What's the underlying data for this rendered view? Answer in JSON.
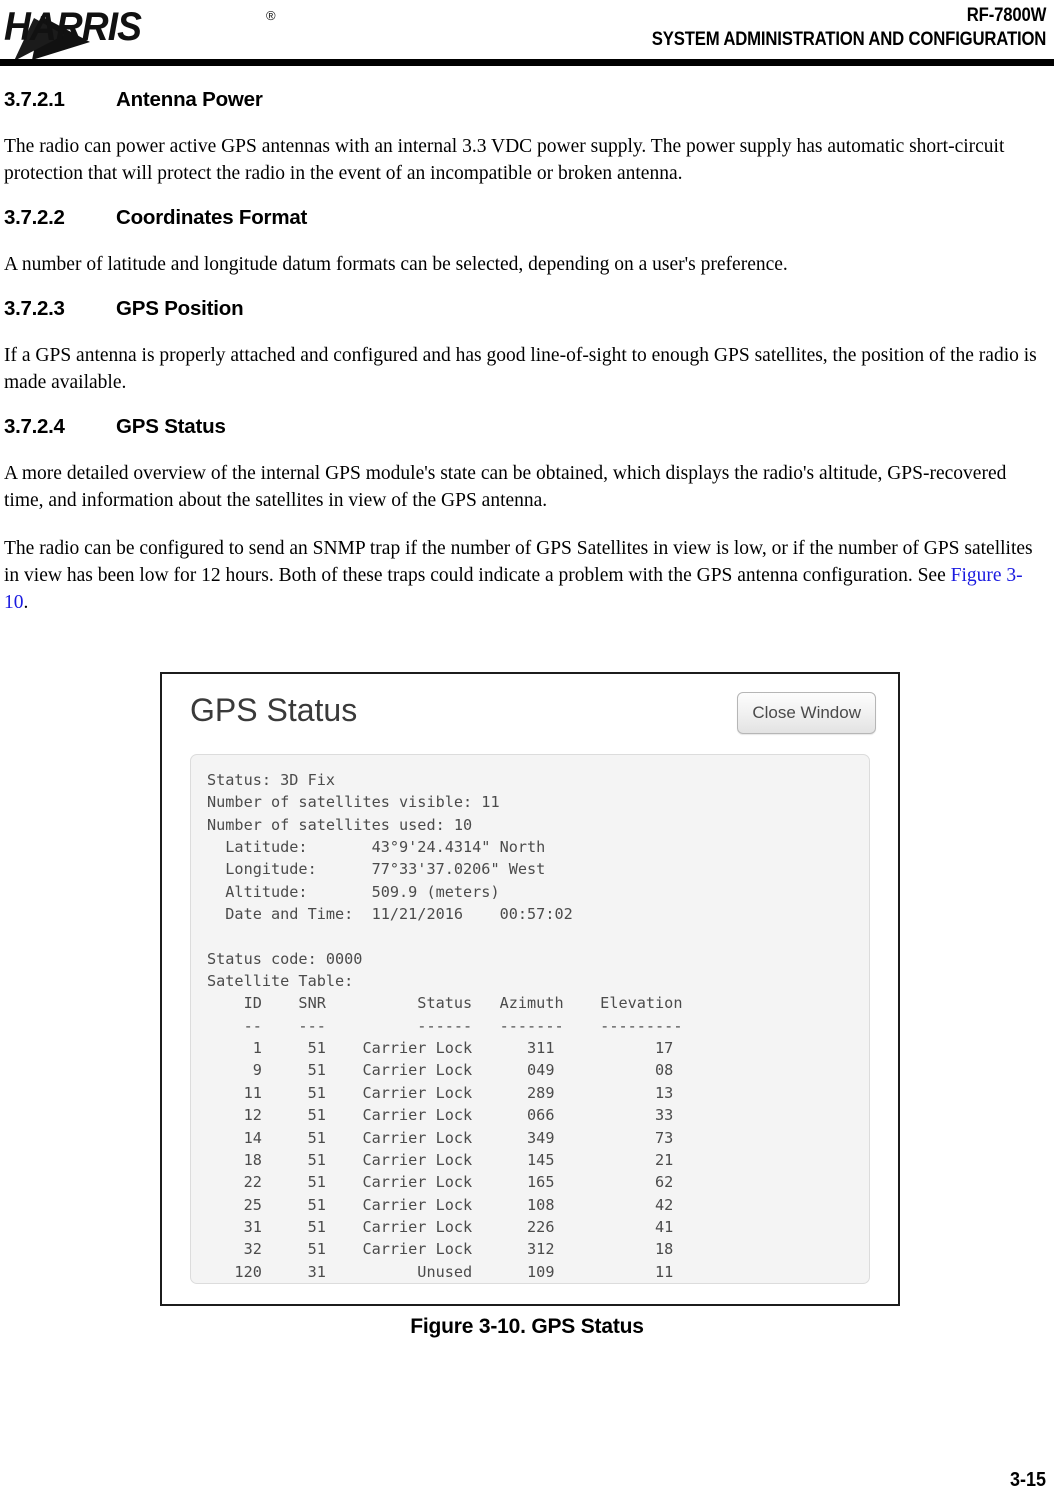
{
  "header": {
    "logo_text": "HARRIS",
    "logo_registered": "®",
    "title_line1": "RF-7800W",
    "title_line2": "SYSTEM ADMINISTRATION AND CONFIGURATION"
  },
  "sections": [
    {
      "number": "3.7.2.1",
      "title": "Antenna Power",
      "body": "The radio can power active GPS antennas with an internal 3.3 VDC power supply. The power supply has automatic short-circuit protection that will protect the radio in the event of an incompatible or broken antenna."
    },
    {
      "number": "3.7.2.2",
      "title": "Coordinates Format",
      "body": "A number of latitude and longitude datum formats can be selected, depending on a user's preference."
    },
    {
      "number": "3.7.2.3",
      "title": "GPS Position",
      "body": "If a GPS antenna is properly attached and configured and has good line-of-sight to enough GPS satellites, the position of the radio is made available."
    },
    {
      "number": "3.7.2.4",
      "title": "GPS Status",
      "body": "A more detailed overview of the internal GPS module's state can be obtained, which displays the radio's altitude, GPS-recovered time, and information about the satellites in view of the GPS antenna."
    }
  ],
  "paragraph_snmp": {
    "before_xref": "The radio can be configured to send an SNMP trap if the number of GPS Satellites in view is low, or if the number of GPS satellites in view has been low for 12 hours. Both of these traps could indicate a problem with the GPS antenna configuration. See ",
    "xref": "Figure 3-10",
    "after_xref": "."
  },
  "figure": {
    "caption": "Figure 3-10.  GPS Status",
    "dialog": {
      "title": "GPS Status",
      "close_button": "Close Window",
      "status_lines": [
        "Status: 3D Fix",
        "Number of satellites visible: 11",
        "Number of satellites used: 10",
        "  Latitude:       43°9'24.4314\" North",
        "  Longitude:      77°33'37.0206\" West",
        "  Altitude:       509.9 (meters)",
        "  Date and Time:  11/21/2016    00:57:02",
        "",
        "Status code: 0000",
        "Satellite Table:",
        "    ID    SNR          Status   Azimuth    Elevation",
        "    --    ---          ------   -------    ---------",
        "     1     51    Carrier Lock      311           17",
        "     9     51    Carrier Lock      049           08",
        "    11     51    Carrier Lock      289           13",
        "    12     51    Carrier Lock      066           33",
        "    14     51    Carrier Lock      349           73",
        "    18     51    Carrier Lock      145           21",
        "    22     51    Carrier Lock      165           62",
        "    25     51    Carrier Lock      108           42",
        "    31     51    Carrier Lock      226           41",
        "    32     51    Carrier Lock      312           18",
        "   120     31          Unused      109           11"
      ],
      "fields": {
        "status": "3D Fix",
        "satellites_visible": "11",
        "satellites_used": "10",
        "latitude": "43°9'24.4314\" North",
        "longitude": "77°33'37.0206\" West",
        "altitude": "509.9 (meters)",
        "date": "11/21/2016",
        "time": "00:57:02",
        "status_code": "0000"
      },
      "satellite_table": {
        "label": "Satellite Table:",
        "columns": [
          "ID",
          "SNR",
          "Status",
          "Azimuth",
          "Elevation"
        ],
        "rows": [
          [
            "1",
            "51",
            "Carrier Lock",
            "311",
            "17"
          ],
          [
            "9",
            "51",
            "Carrier Lock",
            "049",
            "08"
          ],
          [
            "11",
            "51",
            "Carrier Lock",
            "289",
            "13"
          ],
          [
            "12",
            "51",
            "Carrier Lock",
            "066",
            "33"
          ],
          [
            "14",
            "51",
            "Carrier Lock",
            "349",
            "73"
          ],
          [
            "18",
            "51",
            "Carrier Lock",
            "145",
            "21"
          ],
          [
            "22",
            "51",
            "Carrier Lock",
            "165",
            "62"
          ],
          [
            "25",
            "51",
            "Carrier Lock",
            "108",
            "42"
          ],
          [
            "31",
            "51",
            "Carrier Lock",
            "226",
            "41"
          ],
          [
            "32",
            "51",
            "Carrier Lock",
            "312",
            "18"
          ],
          [
            "120",
            "31",
            "Unused",
            "109",
            "11"
          ]
        ]
      }
    }
  },
  "footer": {
    "page_number": "3-15"
  },
  "colors": {
    "xref_link": "#1a1ae0",
    "panel_background": "#f4f4f4",
    "mono_text": "#4b4b4b",
    "rule": "#000000"
  }
}
